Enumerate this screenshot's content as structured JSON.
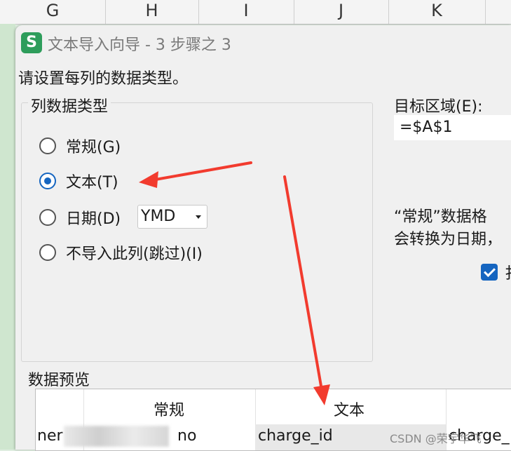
{
  "spreadsheet": {
    "columns": [
      "G",
      "H",
      "I",
      "J",
      "K"
    ]
  },
  "dialog": {
    "app_icon_letter": "S",
    "title": "文本导入向导 - 3 步骤之 3",
    "instruction": "请设置每列的数据类型。",
    "column_type_group": {
      "legend": "列数据类型",
      "options": [
        {
          "label": "常规(G)",
          "checked": false
        },
        {
          "label": "文本(T)",
          "checked": true
        },
        {
          "label": "日期(D)",
          "checked": false
        },
        {
          "label": "不导入此列(跳过)(I)",
          "checked": false
        }
      ],
      "date_format": "YMD"
    },
    "target": {
      "label": "目标区域(E):",
      "value": "=$A$1"
    },
    "description": {
      "line1": "“常规”数据格",
      "line2": "会转换为日期，"
    },
    "checkbox": {
      "checked": true,
      "label": "扌"
    },
    "preview": {
      "label": "数据预览",
      "headers": [
        "",
        "常规",
        "文本",
        ""
      ],
      "row": [
        "ner",
        "no",
        "charge_id",
        "charge_"
      ]
    }
  },
  "watermark": "CSDN @荣宇华飞",
  "colors": {
    "accent": "#1565c0",
    "arrow": "#f23b2e",
    "app_icon": "#2e9d5b"
  }
}
